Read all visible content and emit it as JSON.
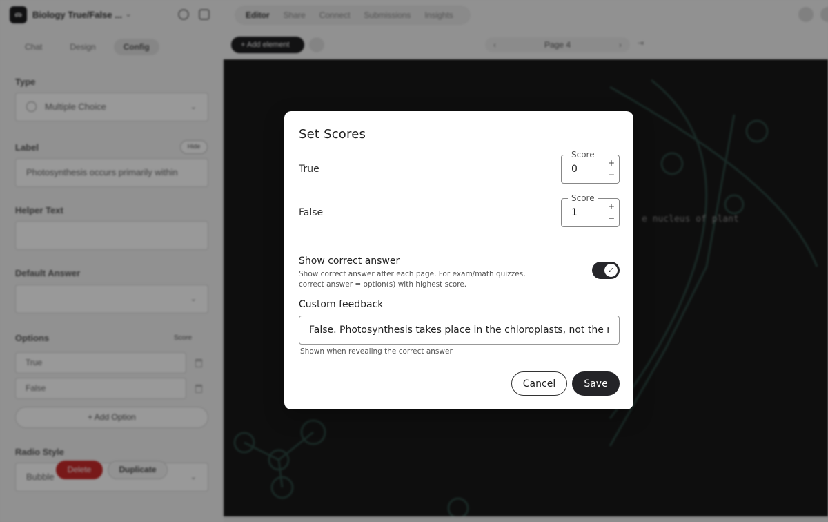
{
  "app": {
    "project_title": "Biology True/False ...",
    "nav_tabs": [
      "Editor",
      "Share",
      "Connect",
      "Submissions",
      "Insights"
    ]
  },
  "sidebar": {
    "tabs": [
      "Chat",
      "Design",
      "Config"
    ],
    "type_label": "Type",
    "type_value": "Multiple Choice",
    "label_label": "Label",
    "hide_label": "Hide",
    "label_value": "Photosynthesis occurs primarily within",
    "helper_text_label": "Helper Text",
    "helper_text_value": "",
    "default_answer_label": "Default Answer",
    "default_answer_value": "",
    "options_label": "Options",
    "score_link": "Score",
    "options": [
      "True",
      "False"
    ],
    "add_option_label": "+ Add Option",
    "radio_style_label": "Radio Style",
    "radio_style_value": "Bubble",
    "delete_label": "Delete",
    "duplicate_label": "Duplicate"
  },
  "editor": {
    "add_element_label": "+ Add element",
    "page_label": "Page 4",
    "canvas_text": "e nucleus of plant"
  },
  "modal": {
    "title": "Set Scores",
    "options": [
      {
        "label": "True",
        "score_legend": "Score",
        "score": "0"
      },
      {
        "label": "False",
        "score_legend": "Score",
        "score": "1"
      }
    ],
    "show_correct_answer": {
      "title": "Show correct answer",
      "description": "Show correct answer after each page. For exam/math quizzes, correct answer = option(s) with highest score.",
      "enabled": true
    },
    "custom_feedback": {
      "title": "Custom feedback",
      "value": "False. Photosynthesis takes place in the chloroplasts, not the nucl",
      "hint": "Shown when revealing the correct answer"
    },
    "cancel_label": "Cancel",
    "save_label": "Save"
  }
}
